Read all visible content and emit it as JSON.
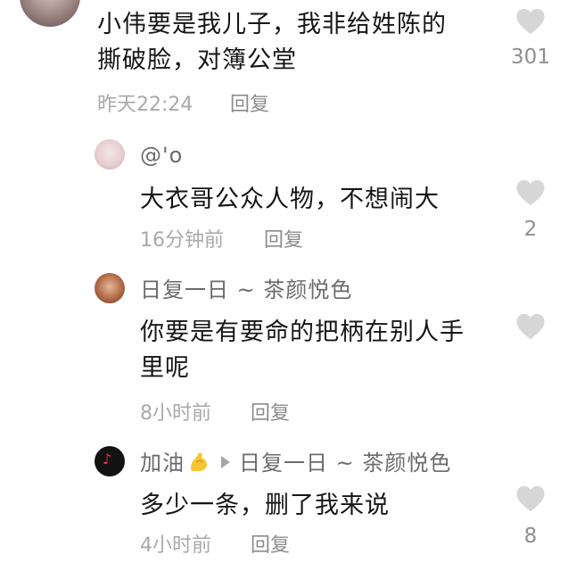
{
  "comments": [
    {
      "lines": [
        "小伟要是我儿子，我非给姓陈的",
        "撕破脸，对簿公堂"
      ],
      "time": "昨天22:24",
      "reply_label": "回复",
      "likes": "301"
    }
  ],
  "replies": [
    {
      "name": "@'o",
      "lines": [
        "大衣哥公众人物，不想闹大"
      ],
      "time": "16分钟前",
      "reply_label": "回复",
      "likes": "2"
    },
    {
      "name": "日复一日 ~ 茶颜悦色",
      "lines": [
        "你要是有要命的把柄在别人手",
        "里呢"
      ],
      "time": "8小时前",
      "reply_label": "回复",
      "likes": ""
    },
    {
      "name": "加油",
      "name_emoji": "flexed-biceps",
      "reply_to": "日复一日 ~ 茶颜悦色",
      "lines": [
        "多少一条，删了我来说"
      ],
      "time": "4小时前",
      "reply_label": "回复",
      "likes": "8"
    }
  ],
  "colors": {
    "text": "#161616",
    "meta": "#a9a9a9",
    "heart": "#d6d6d6",
    "count": "#8f8f8f"
  }
}
